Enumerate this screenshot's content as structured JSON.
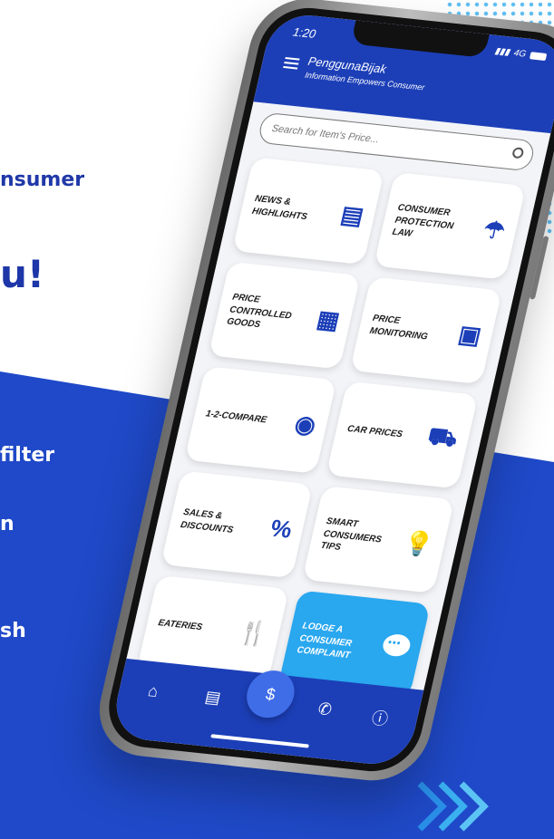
{
  "background": {
    "line1": "nsumer",
    "line2": "u!",
    "line3": "filter",
    "line4": "n",
    "line5": "sh"
  },
  "status": {
    "time": "1:20",
    "network": "4G"
  },
  "app": {
    "title": "PenggunaBijak",
    "subtitle": "Information Empowers Consumer"
  },
  "search": {
    "placeholder": "Search for Item's Price..."
  },
  "tiles": [
    {
      "label": "News & Highlights",
      "icon": "newspaper-icon"
    },
    {
      "label": "Consumer Protection Law",
      "icon": "umbrella-family-icon"
    },
    {
      "label": "Price Controlled Goods",
      "icon": "goods-icon"
    },
    {
      "label": "Price Monitoring",
      "icon": "monitor-chart-icon"
    },
    {
      "label": "1-2-Compare",
      "icon": "compare-tag-icon"
    },
    {
      "label": "Car Prices",
      "icon": "car-icon"
    },
    {
      "label": "Sales & Discounts",
      "icon": "percent-icon"
    },
    {
      "label": "Smart Consumers Tips",
      "icon": "lightbulb-icon"
    },
    {
      "label": "Eateries",
      "icon": "fork-knife-icon"
    },
    {
      "label": "Lodge a Consumer Complaint",
      "icon": "chat-bubble-icon"
    }
  ],
  "nav": [
    "home-icon",
    "book-icon",
    "search-price-icon",
    "phone-icon",
    "info-icon"
  ],
  "colors": {
    "primary": "#1c3fb8",
    "accent": "#29a7ef"
  }
}
